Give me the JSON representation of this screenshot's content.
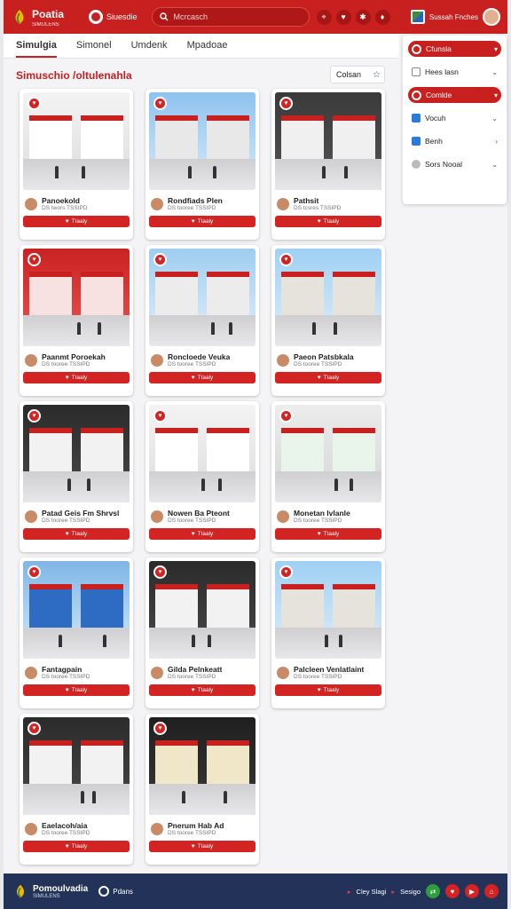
{
  "header": {
    "logo_text": "Poatia",
    "logo_sub": "SIMULENS",
    "brand2": "Siuesdie",
    "search_placeholder": "Mcrcasch",
    "icons": [
      "location-icon",
      "heart-icon",
      "settings-icon",
      "bell-icon"
    ],
    "user_name": "Sussah Fnches"
  },
  "tabs": [
    {
      "label": "Simulgia",
      "active": true
    },
    {
      "label": "Simonel",
      "active": false
    },
    {
      "label": "Umdenk",
      "active": false
    },
    {
      "label": "Mpadoae",
      "active": false
    }
  ],
  "page_title": "Simuschio /oltulenahla",
  "sort": {
    "label": "Colsan",
    "icon": "star-icon"
  },
  "cards": [
    {
      "name": "Panoekold",
      "sub": "DS twors TSSIPD",
      "button": "Ttaaly",
      "scene": "interior"
    },
    {
      "name": "Rondfiads Plen",
      "sub": "DS tooree TSSIPD",
      "button": "Ttaaly",
      "scene": "tower"
    },
    {
      "name": "Pathsit",
      "sub": "DS tcsres TSSIPD",
      "button": "Ttaaly",
      "scene": "store"
    },
    {
      "name": "Paanmt Poroekah",
      "sub": "DS tooree TSSIPD",
      "button": "Ttaaly",
      "scene": "interior-red"
    },
    {
      "name": "Roncloede Veuka",
      "sub": "DS tooree TSSIPD",
      "button": "Ttaaly",
      "scene": "plaza"
    },
    {
      "name": "Paeon Patsbkala",
      "sub": "DS tooree TSSIPD",
      "button": "Ttaaly",
      "scene": "street"
    },
    {
      "name": "Patad Geis Fm Shrvsl",
      "sub": "DS tooree TSSIPD",
      "button": "Ttaaly",
      "scene": "store-dark"
    },
    {
      "name": "Nowen Ba Pteont",
      "sub": "DS tooree TSSIPD",
      "button": "Ttaaly",
      "scene": "interior"
    },
    {
      "name": "Monetan Ivlanle",
      "sub": "DS tooree TSSIPD",
      "button": "Ttaaly",
      "scene": "interior-green"
    },
    {
      "name": "Fantagpain",
      "sub": "DS tooree TSSIPD",
      "button": "Ttaaly",
      "scene": "street-blue"
    },
    {
      "name": "Gilda Pelnkeatt",
      "sub": "DS tooree TSSIPD",
      "button": "Ttaaly",
      "scene": "store-dark"
    },
    {
      "name": "Palcleen Venlatlaint",
      "sub": "DS tooree TSSIPD",
      "button": "Ttaaly",
      "scene": "street"
    },
    {
      "name": "Eaelacoh/aia",
      "sub": "DS tooree TSSIPD",
      "button": "Ttaaly",
      "scene": "store-dark"
    },
    {
      "name": "Pnerum Hab Ad",
      "sub": "DS tooree TSSIPD",
      "button": "Ttaaly",
      "scene": "interior-dark"
    }
  ],
  "filters": [
    {
      "label": "Cfunsla",
      "type": "pill"
    },
    {
      "label": "Hees lasn",
      "type": "checkbox"
    },
    {
      "label": "Comlde",
      "type": "pill"
    },
    {
      "label": "Vocuh",
      "type": "blue"
    },
    {
      "label": "Benh",
      "type": "blue"
    },
    {
      "label": "Sors Nooal",
      "type": "gray"
    }
  ],
  "footer": {
    "logo_text": "Pomoulvadia",
    "logo_sub": "SIMULENS",
    "brand2": "Pdans",
    "link1": "Cley Slagi",
    "link2": "Sesigo"
  },
  "colors": {
    "brand_red": "#c81f1f",
    "footer_navy": "#233259"
  }
}
